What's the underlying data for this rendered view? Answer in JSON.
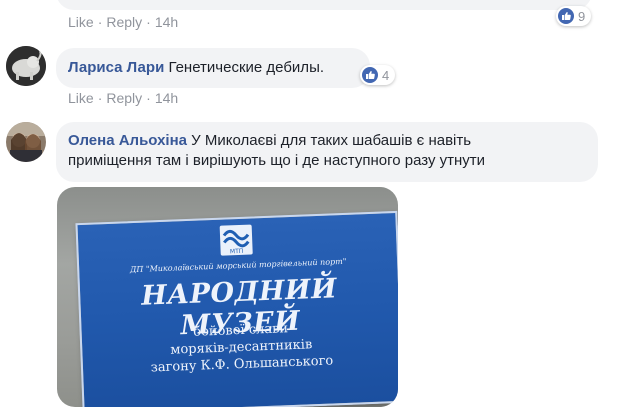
{
  "previous_comment": {
    "actions": {
      "like": "Like",
      "reply": "Reply",
      "time": "14h"
    },
    "reaction_count": "9"
  },
  "comment1": {
    "author": "Лариса Лари",
    "text": "Генетические дебилы.",
    "reaction_count": "4",
    "actions": {
      "like": "Like",
      "reply": "Reply",
      "time": "14h"
    }
  },
  "comment2": {
    "author": "Олена Альохіна",
    "text_line1": "У Миколаєві для таких шабашів є навіть",
    "text_line2": "приміщення там і вирішують що і де наступного разу утнути",
    "attached_photo": {
      "plaque_org": "ДП \"Миколаївський морський торгівельний порт\"",
      "plaque_title": "НАРОДНИЙ МУЗЕЙ",
      "plaque_line1": "бойової слави",
      "plaque_line2": "моряків-десантників",
      "plaque_line3": "загону К.Ф. Ольшанського",
      "logo_text": "МТП"
    }
  },
  "colors": {
    "link": "#385898",
    "meta": "#90949c",
    "bubble": "#f2f3f5",
    "like_blue": "#4267b2"
  },
  "icons": [
    "like-icon"
  ]
}
